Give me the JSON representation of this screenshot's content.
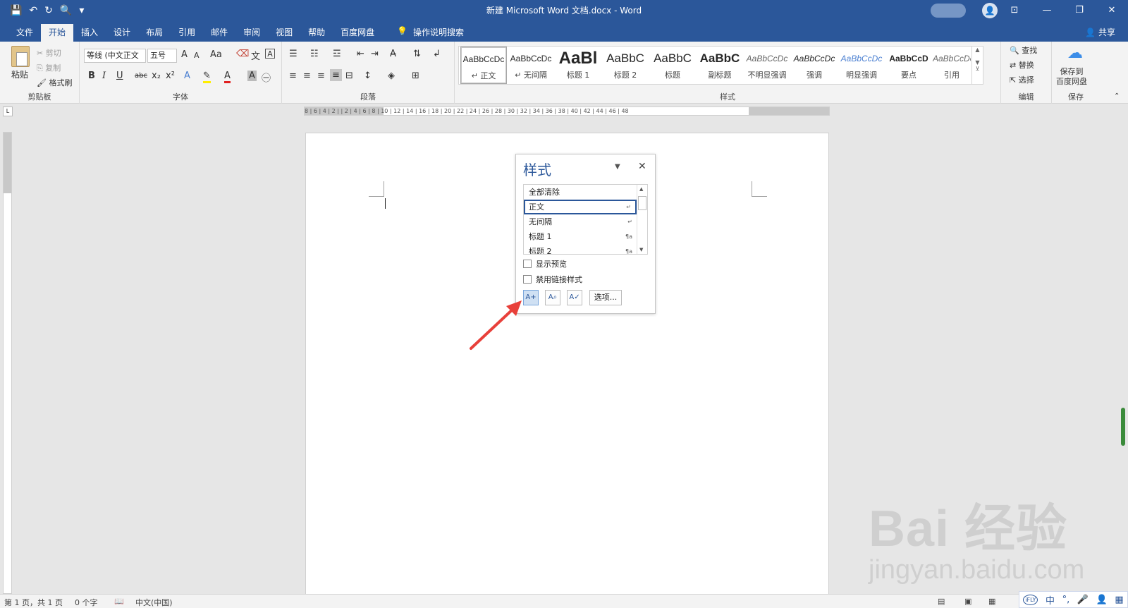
{
  "window": {
    "title": "新建 Microsoft Word 文档.docx  -  Word",
    "controls": {
      "ribbon_display": "⊡",
      "minimize": "—",
      "restore": "❐",
      "close": "✕"
    }
  },
  "qat": {
    "save": "💾",
    "undo": "↶",
    "redo": "↻",
    "preview": "🔍",
    "more": "▾"
  },
  "tabs": [
    "文件",
    "开始",
    "插入",
    "设计",
    "布局",
    "引用",
    "邮件",
    "审阅",
    "视图",
    "帮助",
    "百度网盘"
  ],
  "active_tab": "开始",
  "tell_me": {
    "icon": "💡",
    "label": "操作说明搜索"
  },
  "share": "共享",
  "ribbon": {
    "clipboard": {
      "label": "剪贴板",
      "paste": "粘贴",
      "cut": "剪切",
      "copy": "复制",
      "format_painter": "格式刷"
    },
    "font": {
      "label": "字体",
      "font_name": "等线 (中文正文",
      "font_size": "五号",
      "bold": "B",
      "italic": "I",
      "underline": "U",
      "strike": "abc",
      "sub": "x₂",
      "sup": "x²",
      "grow": "A",
      "shrink": "A",
      "case": "Aa"
    },
    "paragraph": {
      "label": "段落"
    },
    "styles": {
      "label": "样式",
      "items": [
        {
          "preview": "AaBbCcDc",
          "name": "↵ 正文"
        },
        {
          "preview": "AaBbCcDc",
          "name": "↵ 无间隔"
        },
        {
          "preview": "AaBl",
          "name": "标题 1"
        },
        {
          "preview": "AaBbC",
          "name": "标题 2"
        },
        {
          "preview": "AaBbC",
          "name": "标题"
        },
        {
          "preview": "AaBbC",
          "name": "副标题"
        },
        {
          "preview": "AaBbCcDc",
          "name": "不明显强调"
        },
        {
          "preview": "AaBbCcDc",
          "name": "强调"
        },
        {
          "preview": "AaBbCcDc",
          "name": "明显强调"
        },
        {
          "preview": "AaBbCcD",
          "name": "要点"
        },
        {
          "preview": "AaBbCcDc",
          "name": "引用"
        }
      ]
    },
    "editing": {
      "label": "编辑",
      "find": "查找",
      "replace": "替换",
      "select": "选择"
    },
    "save": {
      "label": "保存",
      "save_to_baidu": "保存到\n百度网盘"
    }
  },
  "ruler_text": "8 | 6 | 4 | 2 |   | 2 | 4 | 6 | 8 | 10 | 12 | 14 | 16 | 18 | 20 | 22 | 24 | 26 | 28 | 30 | 32 | 34 | 36 | 38 | 40 | 42 | 44 | 46 | 48",
  "styles_pane": {
    "title": "样式",
    "list": [
      {
        "name": "全部清除",
        "mark": ""
      },
      {
        "name": "正文",
        "mark": "↵"
      },
      {
        "name": "无间隔",
        "mark": "↵"
      },
      {
        "name": "标题 1",
        "mark": "¶a"
      },
      {
        "name": "标题 2",
        "mark": "¶a"
      }
    ],
    "show_preview": "显示预览",
    "disable_linked": "禁用链接样式",
    "options": "选项..."
  },
  "status": {
    "page": "第 1 页，共 1 页",
    "words": "0 个字",
    "lang": "中文(中国)"
  },
  "ime": {
    "logo": "iFLY",
    "lang": "中"
  },
  "watermark": {
    "main": "Bai  经验",
    "sub": "jingyan.baidu.com"
  }
}
